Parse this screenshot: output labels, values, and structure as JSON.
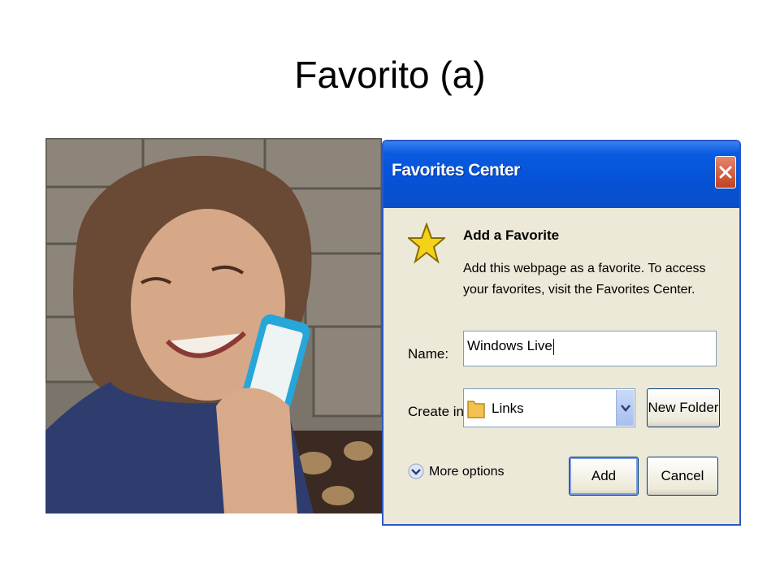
{
  "slide": {
    "title": "Favorito (a)"
  },
  "photo": {
    "subject": "Smiling woman holding a smartphone against her cheek"
  },
  "dialog": {
    "title": "Favorites Center",
    "heading": "Add a Favorite",
    "description": "Add this webpage as a favorite. To access your favorites, visit the Favorites Center.",
    "name_label": "Name:",
    "name_value": "Windows Live",
    "create_in_label": "Create in:",
    "create_in_value": "Links",
    "new_folder_label": "New Folder",
    "more_options_label": "More options",
    "add_label": "Add",
    "cancel_label": "Cancel"
  },
  "colors": {
    "titlebar": "#0552d6",
    "dialog_bg": "#ece9d8",
    "close_button": "#c2411f",
    "star": "#f5d21a"
  },
  "icons": {
    "close": "close-icon",
    "star": "star-icon",
    "folder": "folder-icon",
    "dropdown": "chevron-down-icon",
    "more": "expand-circle-icon"
  }
}
